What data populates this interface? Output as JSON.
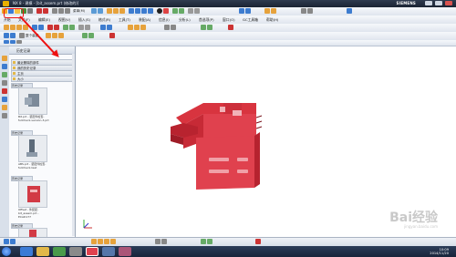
{
  "window": {
    "title": "NX 8 - 建模 - [bit_assem.prt (修改的)]",
    "brand": "SIEMENS"
  },
  "menubar": {
    "items": [
      "开始",
      "文件(F)",
      "编辑(E)",
      "视图(V)",
      "插入(S)",
      "格式(R)",
      "工具(T)",
      "装配(A)",
      "信息(I)",
      "分析(L)",
      "首选项(P)",
      "窗口(O)",
      "GC工具箱",
      "帮助(H)"
    ],
    "combo": "菜单(M)",
    "combo2": "整个装配"
  },
  "navigator": {
    "title": "历史记录",
    "rows": [
      "最近删除的部件",
      "我的历史记录",
      "主页",
      "大小"
    ],
    "sections": [
      "历史记录",
      "历史记录",
      "历史记录",
      "历史记录"
    ],
    "items": [
      {
        "caption": "Bit.prt - 装配件检查-fullcheck-version-3.prt"
      },
      {
        "caption": "ABS.prt - 装配件检查-fullcheck-test"
      },
      {
        "caption": "Offset - 件装配-bit_assem.prt - ECAD177"
      }
    ]
  },
  "watermark": {
    "brand": "Bai经验",
    "url": "jingyan.baidu.com"
  },
  "taskbar": {
    "time": "10:09",
    "date": "2014/11/20"
  },
  "colors": {
    "part": "#e0414e",
    "annotation": "#e11111",
    "toolbar_bg": "#e6ebf2",
    "titlebar_bg": "#243047"
  }
}
